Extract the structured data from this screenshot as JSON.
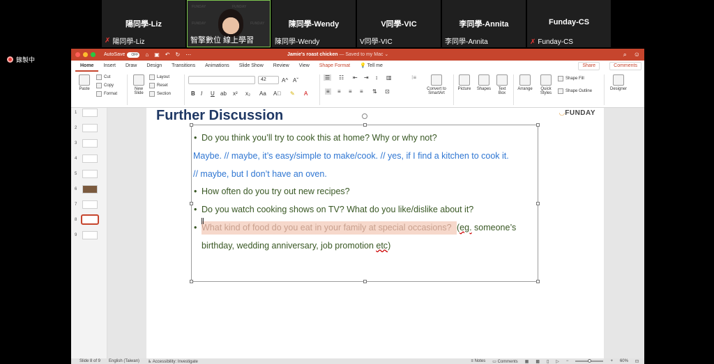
{
  "zoom": {
    "participants": [
      {
        "display_name": "陽同學-Liz",
        "label": "陽同學-Liz",
        "muted": true,
        "video": false
      },
      {
        "display_name": "",
        "label": "智擎數位 線上學習",
        "muted": false,
        "video": true
      },
      {
        "display_name": "陳同學-Wendy",
        "label": "陳同學-Wendy",
        "muted": false,
        "video": false
      },
      {
        "display_name": "V同學-VIC",
        "label": "V同學-VIC",
        "muted": false,
        "video": false
      },
      {
        "display_name": "李同學-Annita",
        "label": "李同學-Annita",
        "muted": false,
        "video": false
      },
      {
        "display_name": "Funday-CS",
        "label": "Funday-CS",
        "muted": true,
        "video": false
      }
    ],
    "recording_label": "錄製中",
    "video_watermark": "FUNDAY"
  },
  "ppt": {
    "autosave_label": "AutoSave",
    "autosave_state": "OFF",
    "doc_name": "Jamie's roast chicken",
    "doc_status": "— Saved to my Mac ⌄",
    "tabs": [
      "Home",
      "Insert",
      "Draw",
      "Design",
      "Transitions",
      "Animations",
      "Slide Show",
      "Review",
      "View",
      "Shape Format"
    ],
    "tell_me": "Tell me",
    "share_label": "Share",
    "comments_label": "Comments",
    "ribbon": {
      "paste": "Paste",
      "cut": "Cut",
      "copy": "Copy",
      "format": "Format",
      "new_slide": "New Slide",
      "layout": "Layout",
      "reset": "Reset",
      "section": "Section",
      "font_size": "42",
      "convert_smartart": "Convert to SmartArt",
      "picture": "Picture",
      "shapes": "Shapes",
      "text_box": "Text Box",
      "arrange": "Arrange",
      "quick_styles": "Quick Styles",
      "shape_fill": "Shape Fill",
      "shape_outline": "Shape Outline",
      "designer": "Designer"
    },
    "slide_numbers": [
      "1",
      "2",
      "3",
      "4",
      "5",
      "6",
      "7",
      "8",
      "9"
    ],
    "selected_slide": 8,
    "slide": {
      "title": "Further Discussion",
      "brand": "FUNDAY",
      "lines": [
        {
          "bullet": "•",
          "text": "Do you think you’ll try to cook this at home? Why or why not?"
        },
        {
          "text": "Maybe. // maybe, it’s easy/simple to make/cook. // yes, if I find a kitchen to cook it."
        },
        {
          "text": "// maybe, but I don’t have an oven."
        },
        {
          "bullet": "•",
          "text": "How often do you try out new recipes?"
        },
        {
          "bullet": "•",
          "text": "Do you watch cooking shows on TV? What do you like/dislike about it?"
        },
        {
          "bullet": "•",
          "highlight": "What kind of food do you eat in your family at special occasions? ",
          "text_a": " (",
          "text_eg": "eg.",
          "text_b": " someone’s"
        },
        {
          "text_a": "birthday, wedding anniversary, job promotion ",
          "text_etc": "etc",
          "text_b": ")"
        }
      ]
    },
    "status": {
      "slide_of": "Slide 8 of 9",
      "language": "English (Taiwan)",
      "accessibility": "Accessibility: Investigate",
      "notes": "Notes",
      "comments": "Comments",
      "zoom": "60%"
    }
  }
}
